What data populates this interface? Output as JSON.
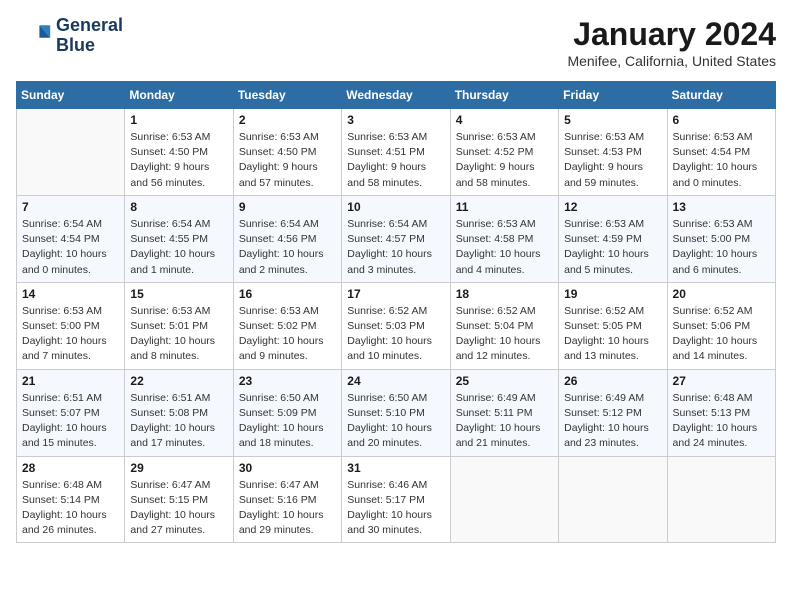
{
  "logo": {
    "line1": "General",
    "line2": "Blue"
  },
  "title": "January 2024",
  "location": "Menifee, California, United States",
  "weekdays": [
    "Sunday",
    "Monday",
    "Tuesday",
    "Wednesday",
    "Thursday",
    "Friday",
    "Saturday"
  ],
  "weeks": [
    [
      {
        "day": "",
        "info": ""
      },
      {
        "day": "1",
        "info": "Sunrise: 6:53 AM\nSunset: 4:50 PM\nDaylight: 9 hours\nand 56 minutes."
      },
      {
        "day": "2",
        "info": "Sunrise: 6:53 AM\nSunset: 4:50 PM\nDaylight: 9 hours\nand 57 minutes."
      },
      {
        "day": "3",
        "info": "Sunrise: 6:53 AM\nSunset: 4:51 PM\nDaylight: 9 hours\nand 58 minutes."
      },
      {
        "day": "4",
        "info": "Sunrise: 6:53 AM\nSunset: 4:52 PM\nDaylight: 9 hours\nand 58 minutes."
      },
      {
        "day": "5",
        "info": "Sunrise: 6:53 AM\nSunset: 4:53 PM\nDaylight: 9 hours\nand 59 minutes."
      },
      {
        "day": "6",
        "info": "Sunrise: 6:53 AM\nSunset: 4:54 PM\nDaylight: 10 hours\nand 0 minutes."
      }
    ],
    [
      {
        "day": "7",
        "info": "Sunrise: 6:54 AM\nSunset: 4:54 PM\nDaylight: 10 hours\nand 0 minutes."
      },
      {
        "day": "8",
        "info": "Sunrise: 6:54 AM\nSunset: 4:55 PM\nDaylight: 10 hours\nand 1 minute."
      },
      {
        "day": "9",
        "info": "Sunrise: 6:54 AM\nSunset: 4:56 PM\nDaylight: 10 hours\nand 2 minutes."
      },
      {
        "day": "10",
        "info": "Sunrise: 6:54 AM\nSunset: 4:57 PM\nDaylight: 10 hours\nand 3 minutes."
      },
      {
        "day": "11",
        "info": "Sunrise: 6:53 AM\nSunset: 4:58 PM\nDaylight: 10 hours\nand 4 minutes."
      },
      {
        "day": "12",
        "info": "Sunrise: 6:53 AM\nSunset: 4:59 PM\nDaylight: 10 hours\nand 5 minutes."
      },
      {
        "day": "13",
        "info": "Sunrise: 6:53 AM\nSunset: 5:00 PM\nDaylight: 10 hours\nand 6 minutes."
      }
    ],
    [
      {
        "day": "14",
        "info": "Sunrise: 6:53 AM\nSunset: 5:00 PM\nDaylight: 10 hours\nand 7 minutes."
      },
      {
        "day": "15",
        "info": "Sunrise: 6:53 AM\nSunset: 5:01 PM\nDaylight: 10 hours\nand 8 minutes."
      },
      {
        "day": "16",
        "info": "Sunrise: 6:53 AM\nSunset: 5:02 PM\nDaylight: 10 hours\nand 9 minutes."
      },
      {
        "day": "17",
        "info": "Sunrise: 6:52 AM\nSunset: 5:03 PM\nDaylight: 10 hours\nand 10 minutes."
      },
      {
        "day": "18",
        "info": "Sunrise: 6:52 AM\nSunset: 5:04 PM\nDaylight: 10 hours\nand 12 minutes."
      },
      {
        "day": "19",
        "info": "Sunrise: 6:52 AM\nSunset: 5:05 PM\nDaylight: 10 hours\nand 13 minutes."
      },
      {
        "day": "20",
        "info": "Sunrise: 6:52 AM\nSunset: 5:06 PM\nDaylight: 10 hours\nand 14 minutes."
      }
    ],
    [
      {
        "day": "21",
        "info": "Sunrise: 6:51 AM\nSunset: 5:07 PM\nDaylight: 10 hours\nand 15 minutes."
      },
      {
        "day": "22",
        "info": "Sunrise: 6:51 AM\nSunset: 5:08 PM\nDaylight: 10 hours\nand 17 minutes."
      },
      {
        "day": "23",
        "info": "Sunrise: 6:50 AM\nSunset: 5:09 PM\nDaylight: 10 hours\nand 18 minutes."
      },
      {
        "day": "24",
        "info": "Sunrise: 6:50 AM\nSunset: 5:10 PM\nDaylight: 10 hours\nand 20 minutes."
      },
      {
        "day": "25",
        "info": "Sunrise: 6:49 AM\nSunset: 5:11 PM\nDaylight: 10 hours\nand 21 minutes."
      },
      {
        "day": "26",
        "info": "Sunrise: 6:49 AM\nSunset: 5:12 PM\nDaylight: 10 hours\nand 23 minutes."
      },
      {
        "day": "27",
        "info": "Sunrise: 6:48 AM\nSunset: 5:13 PM\nDaylight: 10 hours\nand 24 minutes."
      }
    ],
    [
      {
        "day": "28",
        "info": "Sunrise: 6:48 AM\nSunset: 5:14 PM\nDaylight: 10 hours\nand 26 minutes."
      },
      {
        "day": "29",
        "info": "Sunrise: 6:47 AM\nSunset: 5:15 PM\nDaylight: 10 hours\nand 27 minutes."
      },
      {
        "day": "30",
        "info": "Sunrise: 6:47 AM\nSunset: 5:16 PM\nDaylight: 10 hours\nand 29 minutes."
      },
      {
        "day": "31",
        "info": "Sunrise: 6:46 AM\nSunset: 5:17 PM\nDaylight: 10 hours\nand 30 minutes."
      },
      {
        "day": "",
        "info": ""
      },
      {
        "day": "",
        "info": ""
      },
      {
        "day": "",
        "info": ""
      }
    ]
  ]
}
